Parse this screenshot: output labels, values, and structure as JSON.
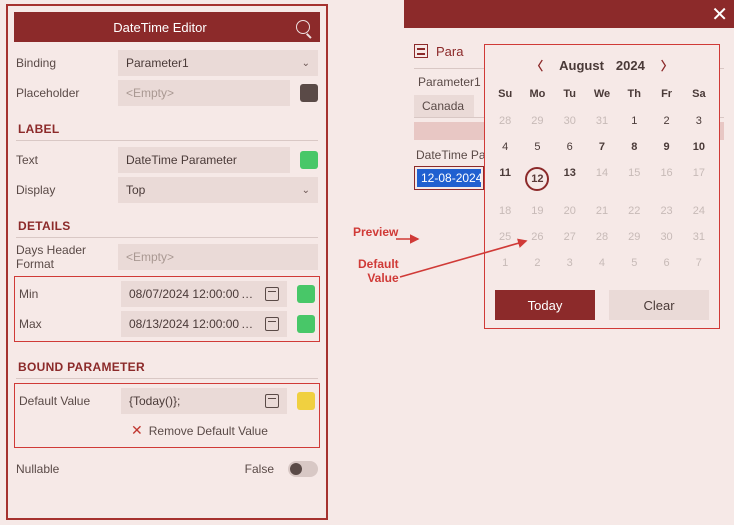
{
  "editor": {
    "title": "DateTime Editor",
    "binding_label": "Binding",
    "binding_value": "Parameter1",
    "placeholder_label": "Placeholder",
    "placeholder_value": "<Empty>",
    "label_section": "LABEL",
    "text_label": "Text",
    "text_value": "DateTime Parameter",
    "display_label": "Display",
    "display_value": "Top",
    "details_section": "DETAILS",
    "days_header_label": "Days Header Format",
    "days_header_value": "<Empty>",
    "min_label": "Min",
    "min_value": "08/07/2024 12:00:00",
    "max_label": "Max",
    "max_value": "08/13/2024 12:00:00",
    "bound_section": "BOUND PARAMETER",
    "default_label": "Default Value",
    "default_value": "{Today()};",
    "remove_default": "Remove Default Value",
    "nullable_label": "Nullable",
    "nullable_value": "False",
    "colors": {
      "placeholder": "#5a4a47",
      "text": "#48c768",
      "min": "#48c768",
      "max": "#48c768",
      "default": "#f0d040"
    }
  },
  "preview": {
    "filter_label": "Parameters",
    "param_header": "Parameter1",
    "param_value": "Canada",
    "dt_label": "DateTime Parameter",
    "dt_value": "12-08-2024"
  },
  "annotations": {
    "preview": "Preview",
    "default_value": "Default Value"
  },
  "calendar": {
    "month": "August",
    "year": "2024",
    "dow": [
      "Su",
      "Mo",
      "Tu",
      "We",
      "Th",
      "Fr",
      "Sa"
    ],
    "weeks": [
      [
        {
          "n": 28,
          "dim": true
        },
        {
          "n": 29,
          "dim": true
        },
        {
          "n": 30,
          "dim": true
        },
        {
          "n": 31,
          "dim": true
        },
        {
          "n": 1
        },
        {
          "n": 2
        },
        {
          "n": 3
        }
      ],
      [
        {
          "n": 4
        },
        {
          "n": 5
        },
        {
          "n": 6
        },
        {
          "n": 7,
          "bold": true
        },
        {
          "n": 8,
          "bold": true
        },
        {
          "n": 9,
          "bold": true
        },
        {
          "n": 10,
          "bold": true
        }
      ],
      [
        {
          "n": 11,
          "bold": true
        },
        {
          "n": 12,
          "ring": true
        },
        {
          "n": 13,
          "bold": true
        },
        {
          "n": 14,
          "dim": true
        },
        {
          "n": 15,
          "dim": true
        },
        {
          "n": 16,
          "dim": true
        },
        {
          "n": 17,
          "dim": true
        }
      ],
      [
        {
          "n": 18,
          "dim": true
        },
        {
          "n": 19,
          "dim": true
        },
        {
          "n": 20,
          "dim": true
        },
        {
          "n": 21,
          "dim": true
        },
        {
          "n": 22,
          "dim": true
        },
        {
          "n": 23,
          "dim": true
        },
        {
          "n": 24,
          "dim": true
        }
      ],
      [
        {
          "n": 25,
          "dim": true
        },
        {
          "n": 26,
          "dim": true
        },
        {
          "n": 27,
          "dim": true
        },
        {
          "n": 28,
          "dim": true
        },
        {
          "n": 29,
          "dim": true
        },
        {
          "n": 30,
          "dim": true
        },
        {
          "n": 31,
          "dim": true
        }
      ],
      [
        {
          "n": 1,
          "dim": true
        },
        {
          "n": 2,
          "dim": true
        },
        {
          "n": 3,
          "dim": true
        },
        {
          "n": 4,
          "dim": true
        },
        {
          "n": 5,
          "dim": true
        },
        {
          "n": 6,
          "dim": true
        },
        {
          "n": 7,
          "dim": true
        }
      ]
    ],
    "today": "Today",
    "clear": "Clear"
  }
}
